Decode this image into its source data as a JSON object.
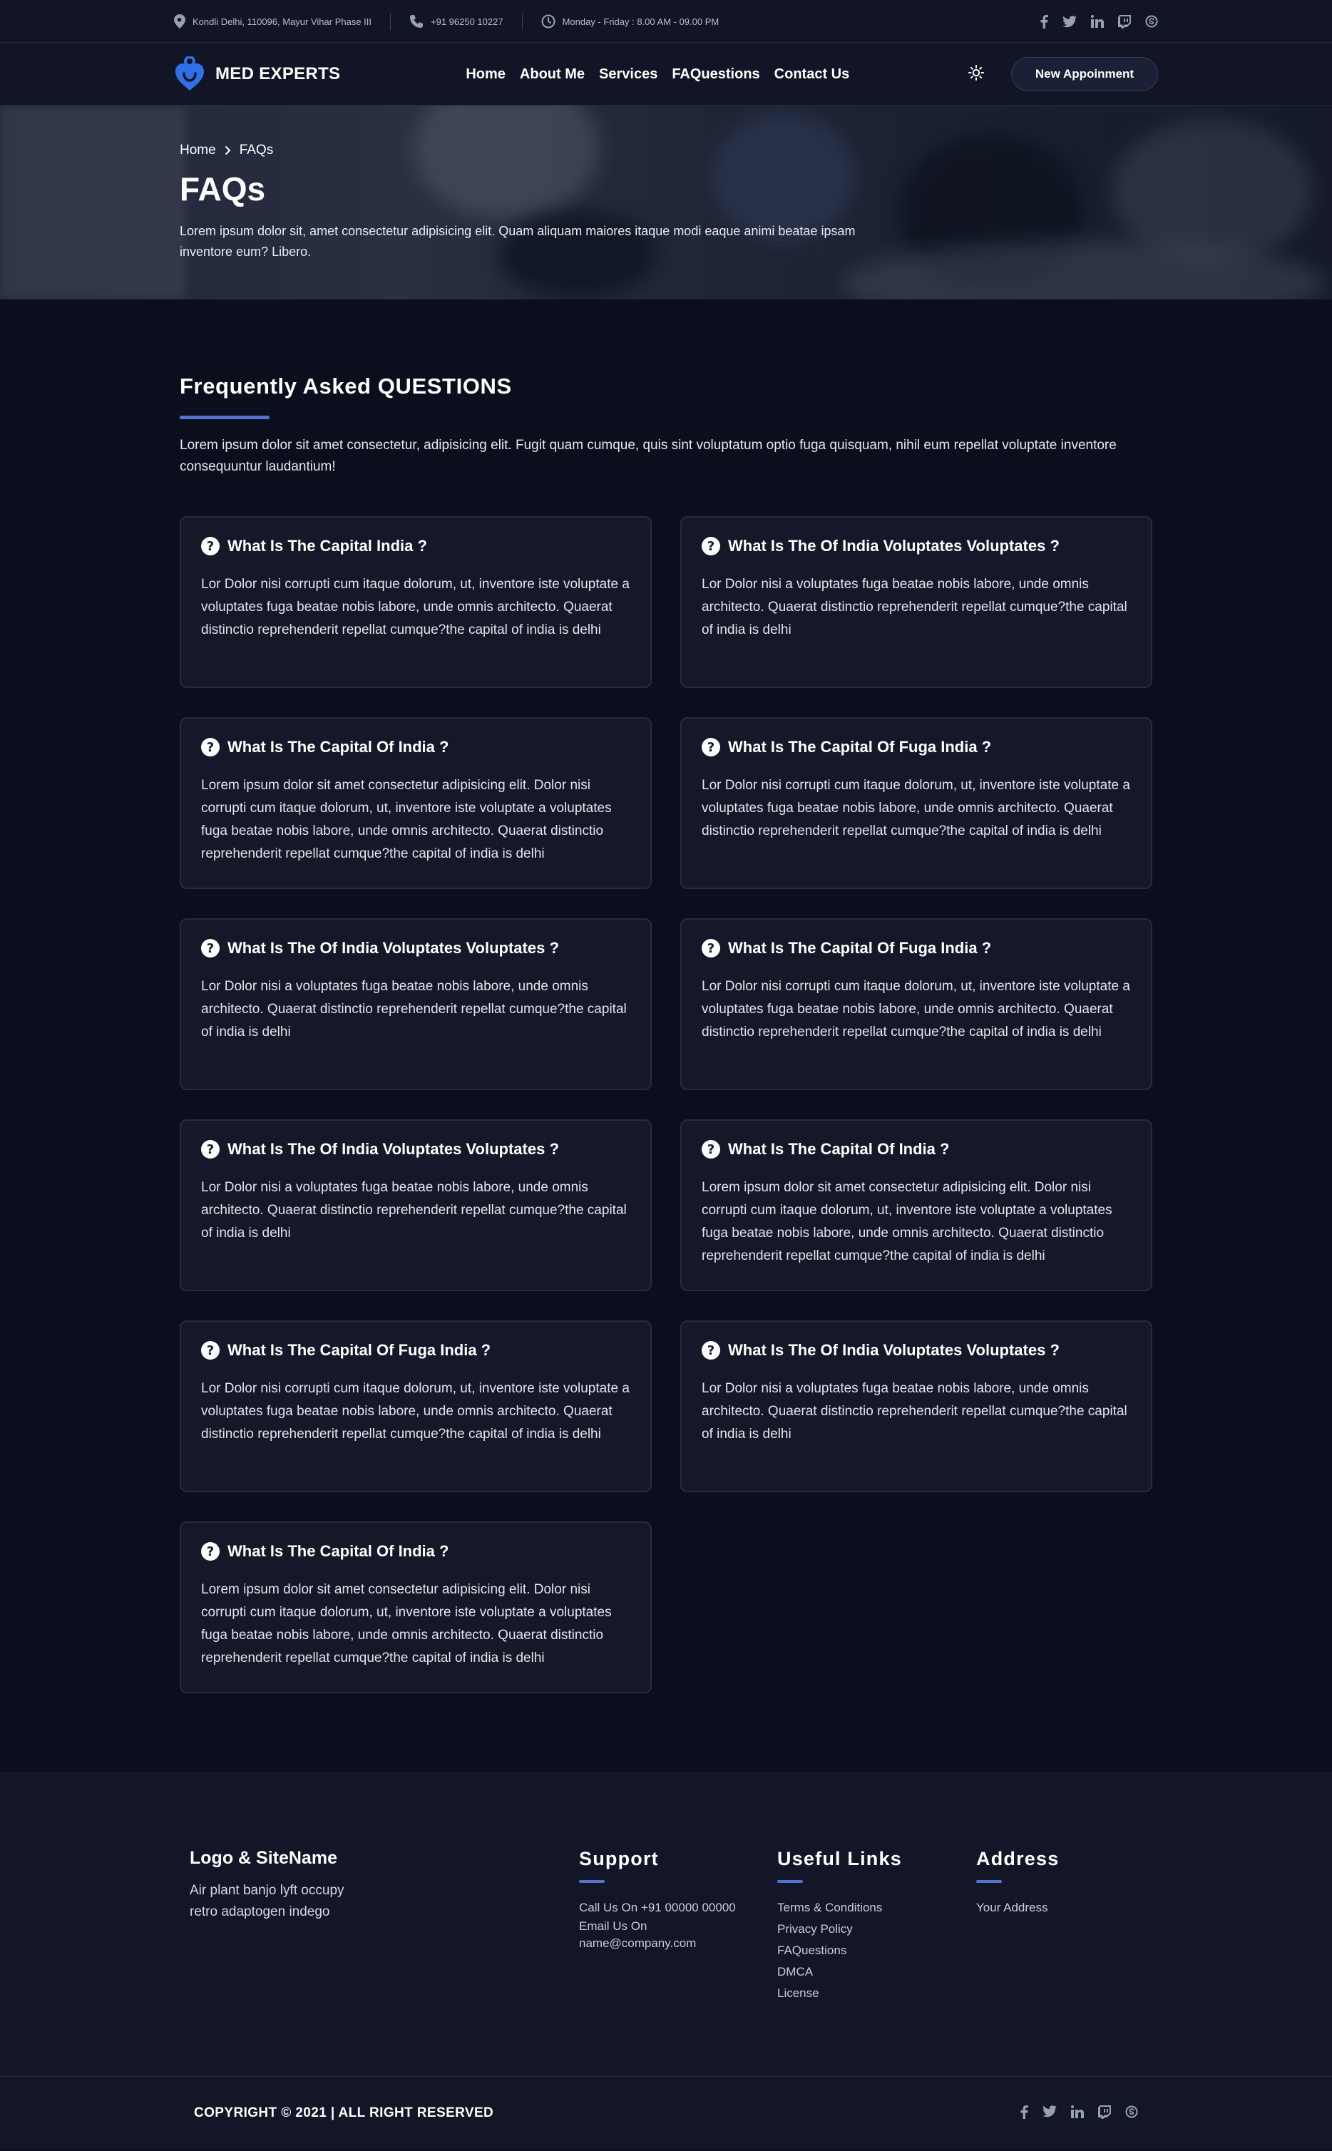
{
  "topbar": {
    "address": "Kondli Delhi, 110096, Mayur Vihar Phase III",
    "phone": "+91 96250 10227",
    "hours": "Monday - Friday : 8.00 AM - 09.00 PM",
    "social_icons": [
      "facebook-icon",
      "twitter-icon",
      "linkedin-icon",
      "twitch-icon",
      "skype-icon"
    ]
  },
  "nav": {
    "brand": "MED EXPERTS",
    "menu": [
      "Home",
      "About Me",
      "Services",
      "FAQuestions",
      "Contact Us"
    ],
    "cta": "New Appoinment"
  },
  "hero": {
    "breadcrumb_home": "Home",
    "breadcrumb_current": "FAQs",
    "title": "FAQs",
    "text": "Lorem ipsum dolor sit, amet consectetur adipisicing elit. Quam aliquam maiores itaque modi eaque animi beatae ipsam inventore eum? Libero."
  },
  "section": {
    "title": "Frequently Asked QUESTIONS",
    "intro": "Lorem ipsum dolor sit amet consectetur, adipisicing elit. Fugit quam cumque, quis sint voluptatum optio fuga quisquam, nihil eum repellat voluptate inventore consequuntur laudantium!"
  },
  "faqs": [
    {
      "q": "What Is The Capital India ?",
      "a": "Lor Dolor nisi corrupti cum itaque dolorum, ut, inventore iste voluptate a voluptates fuga beatae nobis labore, unde omnis architecto. Quaerat distinctio reprehenderit repellat cumque?the capital of india is delhi"
    },
    {
      "q": "What Is The Of India Voluptates Voluptates ?",
      "a": "Lor Dolor nisi a voluptates fuga beatae nobis labore, unde omnis architecto. Quaerat distinctio reprehenderit repellat cumque?the capital of india is delhi"
    },
    {
      "q": "What Is The Capital Of India ?",
      "a": "Lorem ipsum dolor sit amet consectetur adipisicing elit. Dolor nisi corrupti cum itaque dolorum, ut, inventore iste voluptate a voluptates fuga beatae nobis labore, unde omnis architecto. Quaerat distinctio reprehenderit repellat cumque?the capital of india is delhi"
    },
    {
      "q": "What Is The Capital Of Fuga India ?",
      "a": "Lor Dolor nisi corrupti cum itaque dolorum, ut, inventore iste voluptate a voluptates fuga beatae nobis labore, unde omnis architecto. Quaerat distinctio reprehenderit repellat cumque?the capital of india is delhi"
    },
    {
      "q": "What Is The Of India Voluptates Voluptates ?",
      "a": "Lor Dolor nisi a voluptates fuga beatae nobis labore, unde omnis architecto. Quaerat distinctio reprehenderit repellat cumque?the capital of india is delhi"
    },
    {
      "q": "What Is The Capital Of Fuga India ?",
      "a": "Lor Dolor nisi corrupti cum itaque dolorum, ut, inventore iste voluptate a voluptates fuga beatae nobis labore, unde omnis architecto. Quaerat distinctio reprehenderit repellat cumque?the capital of india is delhi"
    },
    {
      "q": "What Is The Of India Voluptates Voluptates ?",
      "a": "Lor Dolor nisi a voluptates fuga beatae nobis labore, unde omnis architecto. Quaerat distinctio reprehenderit repellat cumque?the capital of india is delhi"
    },
    {
      "q": "What Is The Capital Of India ?",
      "a": "Lorem ipsum dolor sit amet consectetur adipisicing elit. Dolor nisi corrupti cum itaque dolorum, ut, inventore iste voluptate a voluptates fuga beatae nobis labore, unde omnis architecto. Quaerat distinctio reprehenderit repellat cumque?the capital of india is delhi"
    },
    {
      "q": "What Is The Capital Of Fuga India ?",
      "a": "Lor Dolor nisi corrupti cum itaque dolorum, ut, inventore iste voluptate a voluptates fuga beatae nobis labore, unde omnis architecto. Quaerat distinctio reprehenderit repellat cumque?the capital of india is delhi"
    },
    {
      "q": "What Is The Of India Voluptates Voluptates ?",
      "a": "Lor Dolor nisi a voluptates fuga beatae nobis labore, unde omnis architecto. Quaerat distinctio reprehenderit repellat cumque?the capital of india is delhi"
    },
    {
      "q": "What Is The Capital Of India ?",
      "a": "Lorem ipsum dolor sit amet consectetur adipisicing elit. Dolor nisi corrupti cum itaque dolorum, ut, inventore iste voluptate a voluptates fuga beatae nobis labore, unde omnis architecto. Quaerat distinctio reprehenderit repellat cumque?the capital of india is delhi"
    }
  ],
  "footer": {
    "about_title": "Logo & SiteName",
    "about_text": "Air plant banjo lyft occupy retro adaptogen indego",
    "support_title": "Support",
    "support_items": [
      "Call Us On +91 00000 00000",
      "Email Us On",
      "name@company.com"
    ],
    "links_title": "Useful Links",
    "links_items": [
      "Terms & Conditions",
      "Privacy Policy",
      "FAQuestions",
      "DMCA",
      "License"
    ],
    "address_title": "Address",
    "address_items": [
      "Your Address"
    ],
    "copyright": "COPYRIGHT © 2021 | ALL RIGHT RESERVED"
  },
  "colors": {
    "accent": "#5273d0",
    "brand_blue": "#2f6fe8",
    "background": "#0b0f1d",
    "card": "#141828"
  }
}
